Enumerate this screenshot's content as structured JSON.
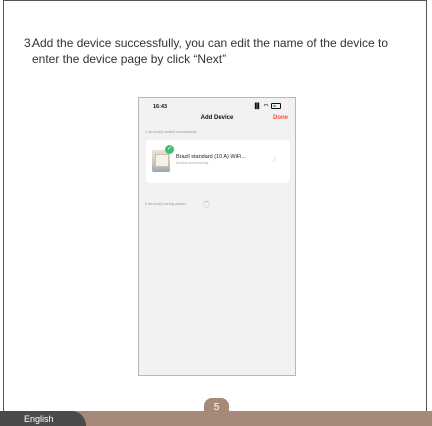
{
  "instruction": {
    "number": "3.",
    "text": "Add the device successfully, you can edit the name of the device to enter the device page by click “Next”"
  },
  "phone": {
    "status_time": "16:43",
    "status_icons": "••• ◠",
    "nav_title": "Add Device",
    "nav_done": "Done",
    "added_label": "1 device(s) added successfully",
    "device": {
      "name": "Brazil standard (10 A) WiFi...",
      "status": "Added successfully"
    },
    "adding_label": "0 device(s) being added"
  },
  "footer": {
    "language": "English",
    "page_number": "5"
  }
}
